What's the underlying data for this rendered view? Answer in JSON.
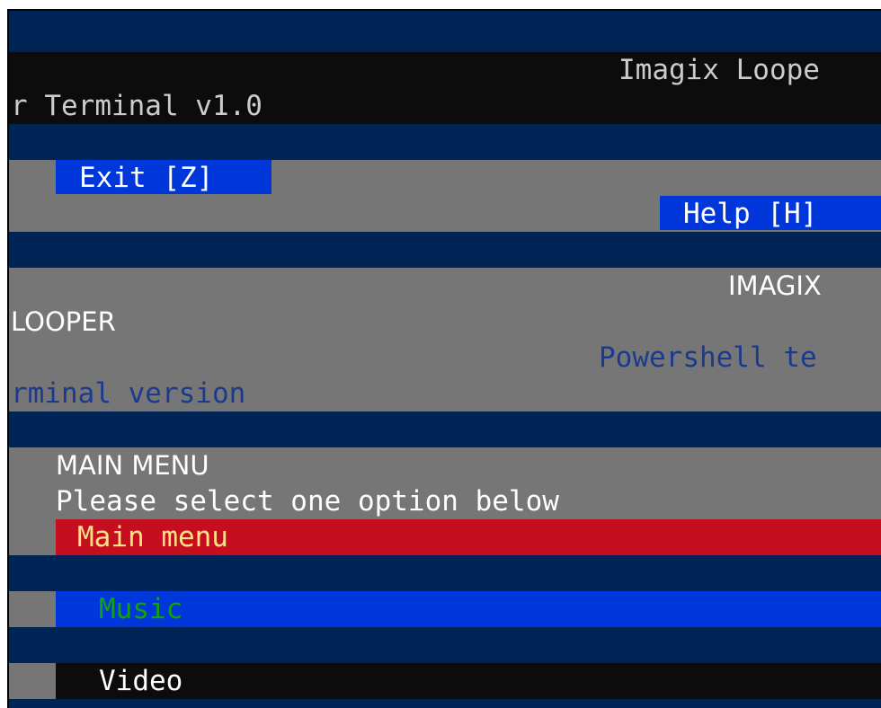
{
  "title_bar": {
    "line1": "Imagix Loope",
    "line2": "r Terminal v1.0"
  },
  "toolbar": {
    "exit_label": "Exit [Z]",
    "help_label": "Help [H]"
  },
  "banner": {
    "app_name_line1": "IMAGIX",
    "app_name_line2": "LOOPER",
    "subtitle_line1": "Powershell te",
    "subtitle_line2": "rminal version"
  },
  "menu": {
    "heading": "MAIN MENU",
    "instruction": "Please select one option below",
    "selected_label": "Main menu",
    "items": [
      {
        "label": "Music"
      },
      {
        "label": "Video"
      }
    ]
  },
  "colors": {
    "terminal_bg": "#012456",
    "panel_gray": "#767676",
    "bar_black": "#0c0c0c",
    "button_blue": "#0037da",
    "selected_red": "#c50f1f",
    "music_green": "#13a10e",
    "subtitle_blue": "#1c3a8c"
  }
}
